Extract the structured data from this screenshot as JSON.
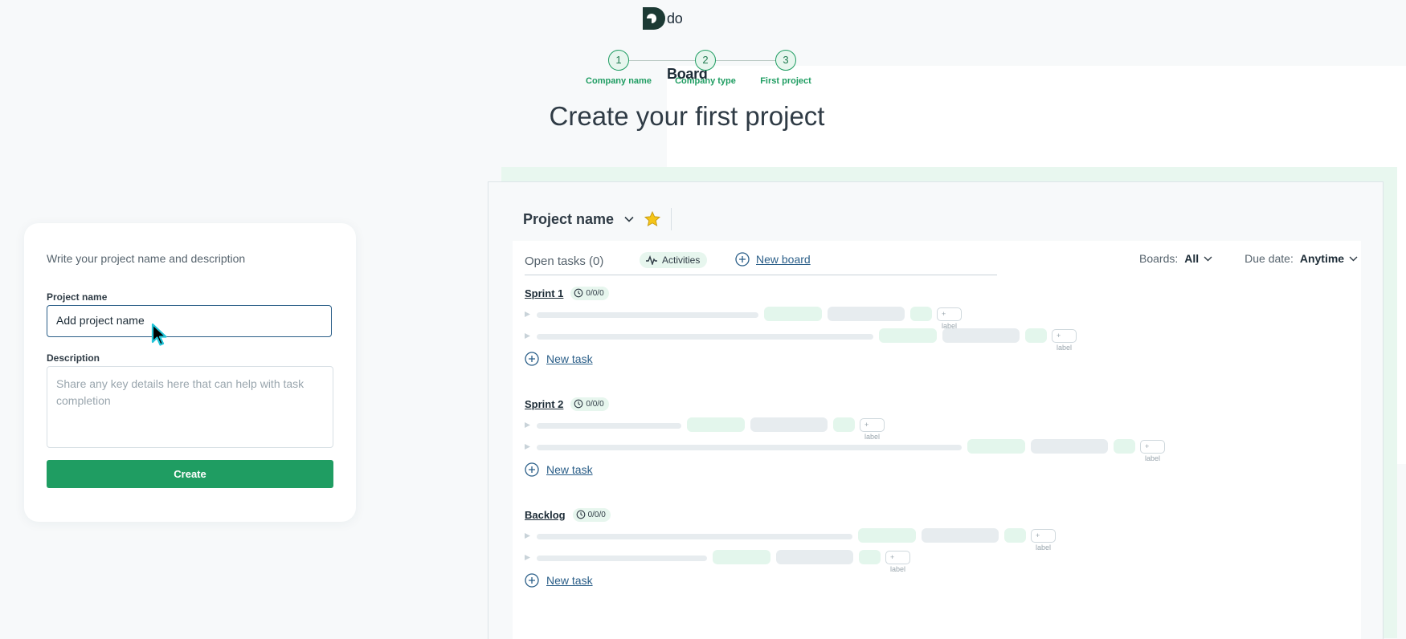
{
  "brand": {
    "name_light": "do",
    "name_bold": "Board"
  },
  "steps": [
    {
      "number": "1",
      "label": "Company name"
    },
    {
      "number": "2",
      "label": "Company type"
    },
    {
      "number": "3",
      "label": "First project"
    }
  ],
  "headline": "Create your first project",
  "form": {
    "intro": "Write your project name and description",
    "project_name_label": "Project name",
    "project_name_value": "Add project name",
    "description_label": "Description",
    "description_placeholder": "Share any key details here that can help with task completion",
    "create_label": "Create"
  },
  "preview": {
    "project_title": "Project name",
    "tabs": {
      "open_tasks": "Open tasks (0)",
      "activities": "Activities",
      "new_board": "New board"
    },
    "filters": {
      "boards_label": "Boards:",
      "boards_value": "All",
      "due_label": "Due date:",
      "due_value": "Anytime"
    },
    "sprints": [
      {
        "title": "Sprint 1",
        "count": "0/0/0",
        "new_task": "New task"
      },
      {
        "title": "Sprint 2",
        "count": "0/0/0",
        "new_task": "New task"
      },
      {
        "title": "Backlog",
        "count": "0/0/0",
        "new_task": "New task"
      }
    ],
    "label_tag": "+ label"
  },
  "colors": {
    "accent": "#1f9d62",
    "link": "#2a5e88",
    "star": "#f5c518"
  }
}
